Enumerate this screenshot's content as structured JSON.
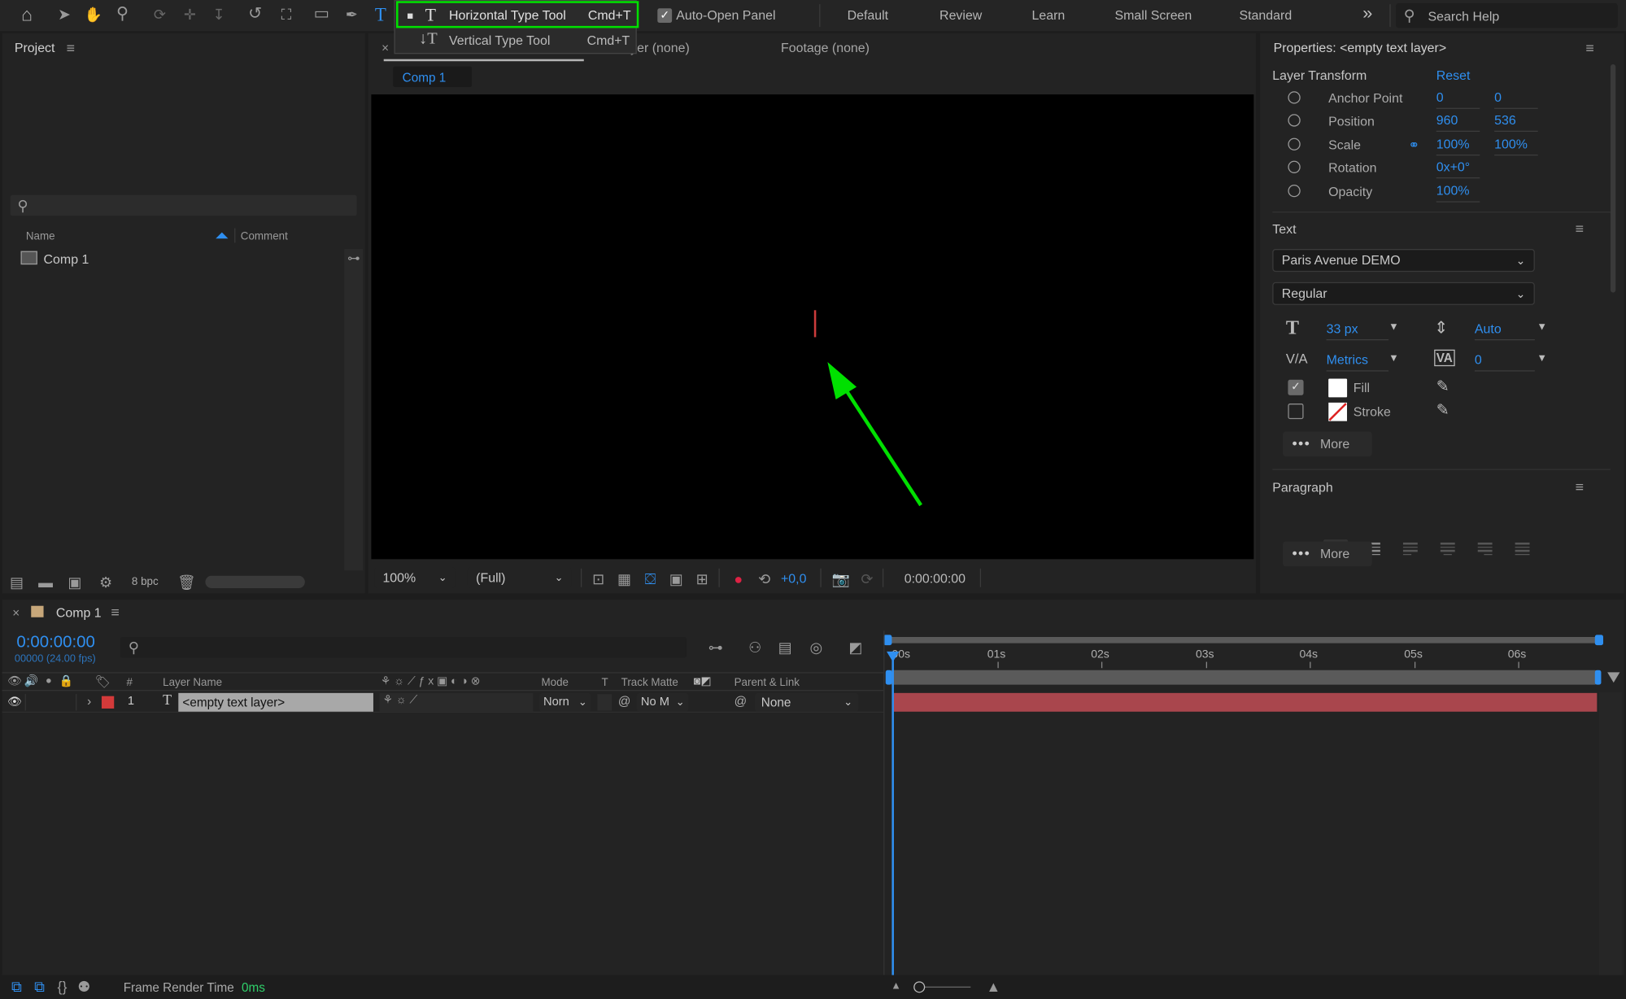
{
  "toolbar": {
    "auto_open_label": "Auto-Open Panel",
    "workspaces": [
      "Default",
      "Review",
      "Learn",
      "Small Screen",
      "Standard"
    ],
    "more_glyph": "»",
    "search_placeholder": "Search Help"
  },
  "type_menu": {
    "items": [
      {
        "label": "Horizontal Type Tool",
        "shortcut": "Cmd+T",
        "icon": "T"
      },
      {
        "label": "Vertical Type Tool",
        "shortcut": "Cmd+T",
        "icon": "↓T"
      }
    ]
  },
  "project": {
    "title": "Project",
    "col_name": "Name",
    "col_comment": "Comment",
    "items": [
      "Comp 1"
    ],
    "bpc": "8 bpc"
  },
  "viewer": {
    "tabs": [
      "yer (none)",
      "Footage (none)"
    ],
    "comp_tab": "Comp 1",
    "zoom": "100%",
    "resolution": "(Full)",
    "exposure": "+0,0",
    "timecode": "0:00:00:00"
  },
  "properties": {
    "title": "Properties: <empty text layer>",
    "layer_transform": "Layer Transform",
    "reset": "Reset",
    "rows": [
      {
        "label": "Anchor Point",
        "v1": "0",
        "v2": "0"
      },
      {
        "label": "Position",
        "v1": "960",
        "v2": "536"
      },
      {
        "label": "Scale",
        "v1": "100%",
        "v2": "100%"
      },
      {
        "label": "Rotation",
        "v1": "0x+0°",
        "v2": ""
      },
      {
        "label": "Opacity",
        "v1": "100%",
        "v2": ""
      }
    ],
    "text_section": "Text",
    "font": "Paris Avenue DEMO",
    "style": "Regular",
    "font_size": "33 px",
    "leading": "Auto",
    "kerning": "Metrics",
    "tracking": "0",
    "fill": "Fill",
    "stroke": "Stroke",
    "more": "More",
    "paragraph": "Paragraph",
    "more2": "More"
  },
  "timeline": {
    "comp_tab": "Comp 1",
    "timecode": "0:00:00:00",
    "frames": "00000 (24.00 fps)",
    "ticks": [
      "00s",
      "01s",
      "02s",
      "03s",
      "04s",
      "05s",
      "06s"
    ],
    "columns": {
      "num": "#",
      "layer_name": "Layer Name",
      "mode": "Mode",
      "t": "T",
      "track_matte": "Track Matte",
      "parent_link": "Parent & Link"
    },
    "layer": {
      "index": "1",
      "name": "<empty text layer>",
      "mode": "Norn",
      "matte": "No M",
      "parent": "None"
    }
  },
  "status": {
    "frame_render_label": "Frame Render Time",
    "frame_render_value": "0ms"
  },
  "colors": {
    "highlight": "#00e000",
    "accent": "#2f8ff0",
    "layer_label": "#d33a3a",
    "layer_bar": "#a9464d"
  }
}
